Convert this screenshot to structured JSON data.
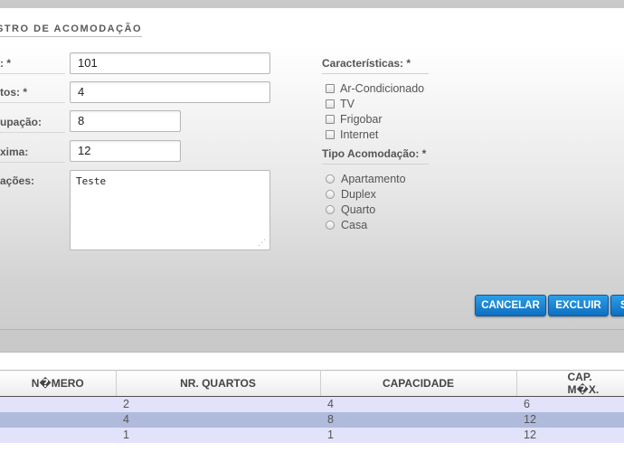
{
  "form": {
    "title": "STRO DE ACOMODAÇÃO",
    "fields": [
      {
        "label": ": *",
        "value": "101"
      },
      {
        "label": "tos: *",
        "value": "4"
      },
      {
        "label": "upação:",
        "value": "8"
      },
      {
        "label": "xima:",
        "value": "12"
      },
      {
        "label": "ações:",
        "value": "Teste"
      }
    ],
    "characteristics": {
      "title": "Características: *",
      "options": [
        "Ar-Condicionado",
        "TV",
        "Frigobar",
        "Internet"
      ]
    },
    "accommodation_type": {
      "title": "Tipo Acomodação: *",
      "options": [
        "Apartamento",
        "Duplex",
        "Quarto",
        "Casa"
      ]
    },
    "buttons": {
      "cancel": "CANCELAR",
      "delete": "EXCLUIR",
      "save": "S"
    }
  },
  "table": {
    "columns": [
      "N�MERO",
      "NR. QUARTOS",
      "CAPACIDADE",
      "CAP. M�X."
    ],
    "rows": [
      [
        "",
        "2",
        "4",
        "6"
      ],
      [
        "",
        "4",
        "8",
        "12"
      ],
      [
        "",
        "1",
        "1",
        "12"
      ]
    ]
  },
  "colors": {
    "button_blue": "#1a86d6",
    "row_light": "#e2e2fb",
    "row_selected": "#b0bbdc"
  },
  "icons": {
    "resize": "resize-grip-icon"
  }
}
